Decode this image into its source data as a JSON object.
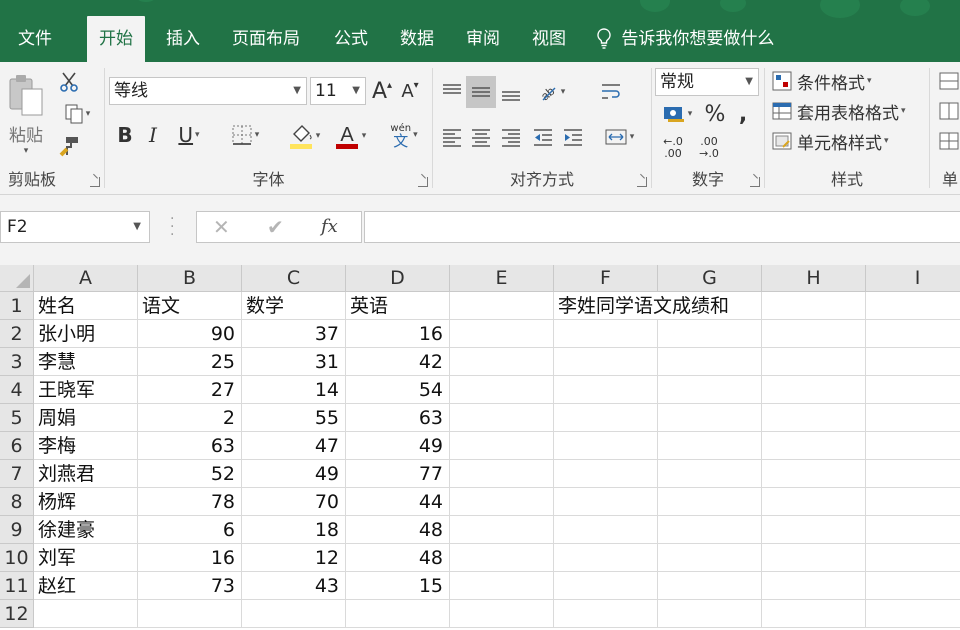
{
  "tabs": [
    "文件",
    "开始",
    "插入",
    "页面布局",
    "公式",
    "数据",
    "审阅",
    "视图"
  ],
  "tell_me": "告诉我你想要做什么",
  "ribbon": {
    "clipboard": {
      "paste": "粘贴",
      "label": "剪贴板"
    },
    "font": {
      "name": "等线",
      "size": "11",
      "grow": "A",
      "shrink": "A",
      "bold": "B",
      "italic": "I",
      "underline": "U",
      "color_letter": "A",
      "pinyin_top": "wén",
      "pinyin_bottom": "文",
      "label": "字体",
      "fill_color": "#ffe45c",
      "font_color": "#c00000"
    },
    "align": {
      "label": "对齐方式"
    },
    "number": {
      "format": "常规",
      "percent": "%",
      "comma": ",",
      "inc_decimal_top": "←.0",
      "inc_decimal_bottom": ".00",
      "dec_decimal_top": ".00",
      "dec_decimal_bottom": "→.0",
      "label": "数字"
    },
    "styles": {
      "conditional": "条件格式",
      "table": "套用表格格式",
      "cell": "单元格样式",
      "label": "样式"
    },
    "cells_label": "单"
  },
  "formula_bar": {
    "name_box": "F2",
    "cancel": "✕",
    "enter": "✔",
    "fx": "fx",
    "formula": ""
  },
  "columns": [
    "A",
    "B",
    "C",
    "D",
    "E",
    "F",
    "G",
    "H",
    "I"
  ],
  "rows": [
    "1",
    "2",
    "3",
    "4",
    "5",
    "6",
    "7",
    "8",
    "9",
    "10",
    "11",
    "12"
  ],
  "headers": {
    "name": "姓名",
    "chinese": "语文",
    "math": "数学",
    "english": "英语"
  },
  "records": [
    {
      "name": "张小明",
      "chinese": "90",
      "math": "37",
      "english": "16"
    },
    {
      "name": "李慧",
      "chinese": "25",
      "math": "31",
      "english": "42"
    },
    {
      "name": "王晓军",
      "chinese": "27",
      "math": "14",
      "english": "54"
    },
    {
      "name": "周娟",
      "chinese": "2",
      "math": "55",
      "english": "63"
    },
    {
      "name": "李梅",
      "chinese": "63",
      "math": "47",
      "english": "49"
    },
    {
      "name": "刘燕君",
      "chinese": "52",
      "math": "49",
      "english": "77"
    },
    {
      "name": "杨辉",
      "chinese": "78",
      "math": "70",
      "english": "44"
    },
    {
      "name": "徐建豪",
      "chinese": "6",
      "math": "18",
      "english": "48"
    },
    {
      "name": "刘军",
      "chinese": "16",
      "math": "12",
      "english": "48"
    },
    {
      "name": "赵红",
      "chinese": "73",
      "math": "43",
      "english": "15"
    }
  ],
  "f1_note": "李姓同学语文成绩和",
  "theme": {
    "accent": "#217346",
    "ribbon_bg": "#f3f3f3",
    "header_bg": "#e6e6e6",
    "gridline": "#dadada"
  }
}
